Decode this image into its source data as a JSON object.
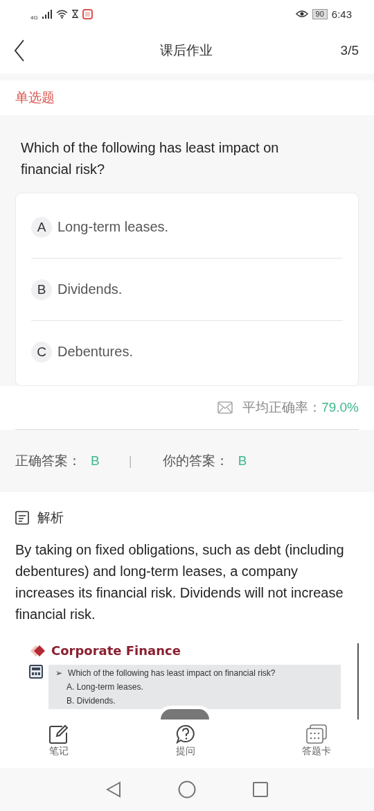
{
  "status_bar": {
    "network": "4G",
    "battery": "90",
    "time": "6:43"
  },
  "header": {
    "title": "课后作业",
    "progress": "3/5"
  },
  "question": {
    "type_label": "单选题",
    "text": "Which of the following has least impact on financial risk?",
    "options": [
      {
        "letter": "A",
        "text": "Long-term leases."
      },
      {
        "letter": "B",
        "text": "Dividends."
      },
      {
        "letter": "C",
        "text": "Debentures."
      }
    ]
  },
  "stats": {
    "accuracy_label": "平均正确率：",
    "accuracy_value": "79.0%"
  },
  "answers": {
    "correct_label": "正确答案：",
    "correct_value": "B",
    "separator": "|",
    "yours_label": "你的答案：",
    "yours_value": "B"
  },
  "analysis": {
    "title": "解析",
    "text": "By taking on fixed obligations, such as debt (including debentures) and long-term leases, a company increases its financial risk. Dividends will not increase financial risk.",
    "slide": {
      "title": "Corporate Finance",
      "bullet": "➢",
      "question": "Which of the following has least impact on financial risk?",
      "lines": [
        "A. Long-term leases.",
        "B. Dividends."
      ]
    }
  },
  "toolbar": [
    {
      "kind": "note",
      "label": "笔记"
    },
    {
      "kind": "ask",
      "label": "提问"
    },
    {
      "kind": "card",
      "label": "答题卡"
    }
  ]
}
